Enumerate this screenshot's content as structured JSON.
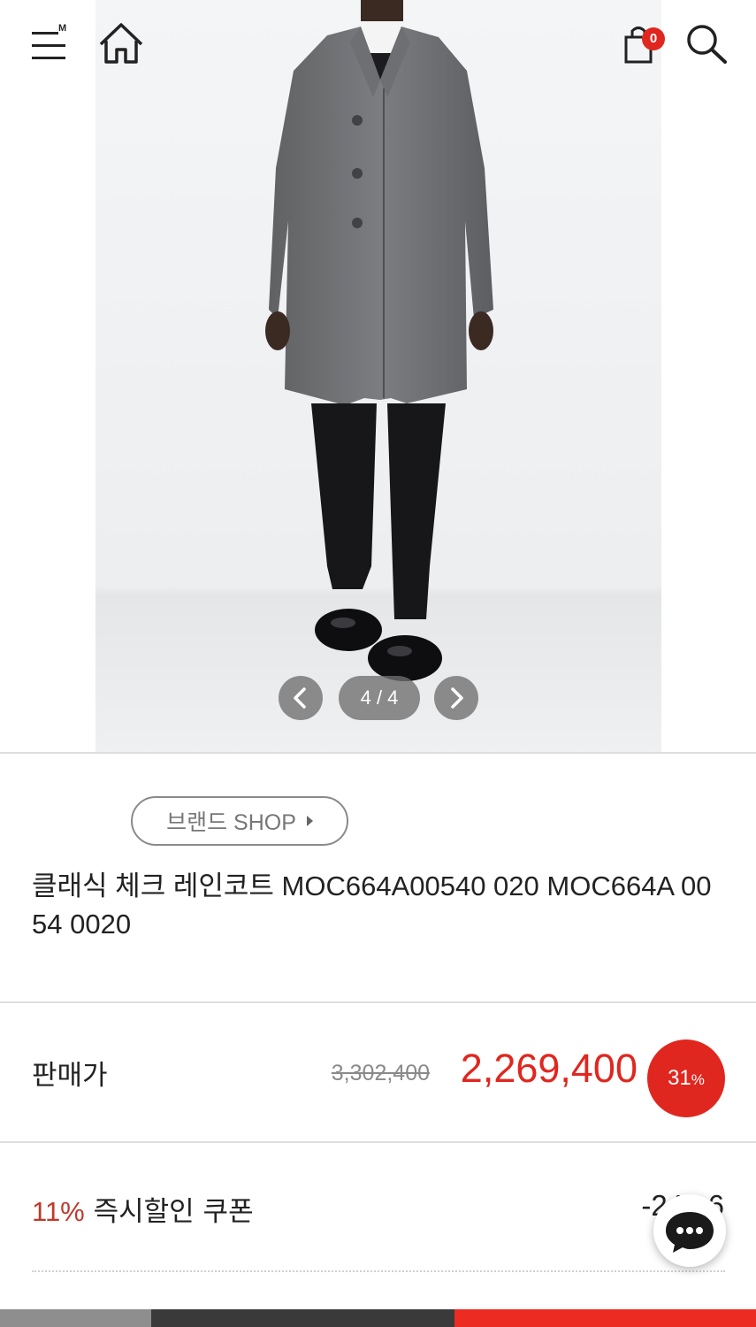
{
  "header": {
    "menu_mark": "M",
    "cart_count": "0",
    "icons": [
      "hamburger-menu-icon",
      "home-icon",
      "shopping-bag-icon",
      "search-icon"
    ]
  },
  "gallery": {
    "counter": "4 / 4",
    "icons": [
      "chevron-left-icon",
      "chevron-right-icon"
    ]
  },
  "product": {
    "brand_shop_label": "브랜드 SHOP",
    "title": "클래식 체크 레인코트 MOC664A00540 020 MOC664A 0054 0020"
  },
  "price": {
    "label": "판매가",
    "original": "3,302,400",
    "sale": "2,269,400",
    "discount_value": "31",
    "discount_unit": "%"
  },
  "coupon": {
    "percent": "11%",
    "label": "즉시할인 쿠폰",
    "amount": "-249,6"
  },
  "colors": {
    "accent": "#e0271f",
    "bottom_bar": [
      "#8e8e8e",
      "#3a3a3a",
      "#ec2b22"
    ]
  }
}
